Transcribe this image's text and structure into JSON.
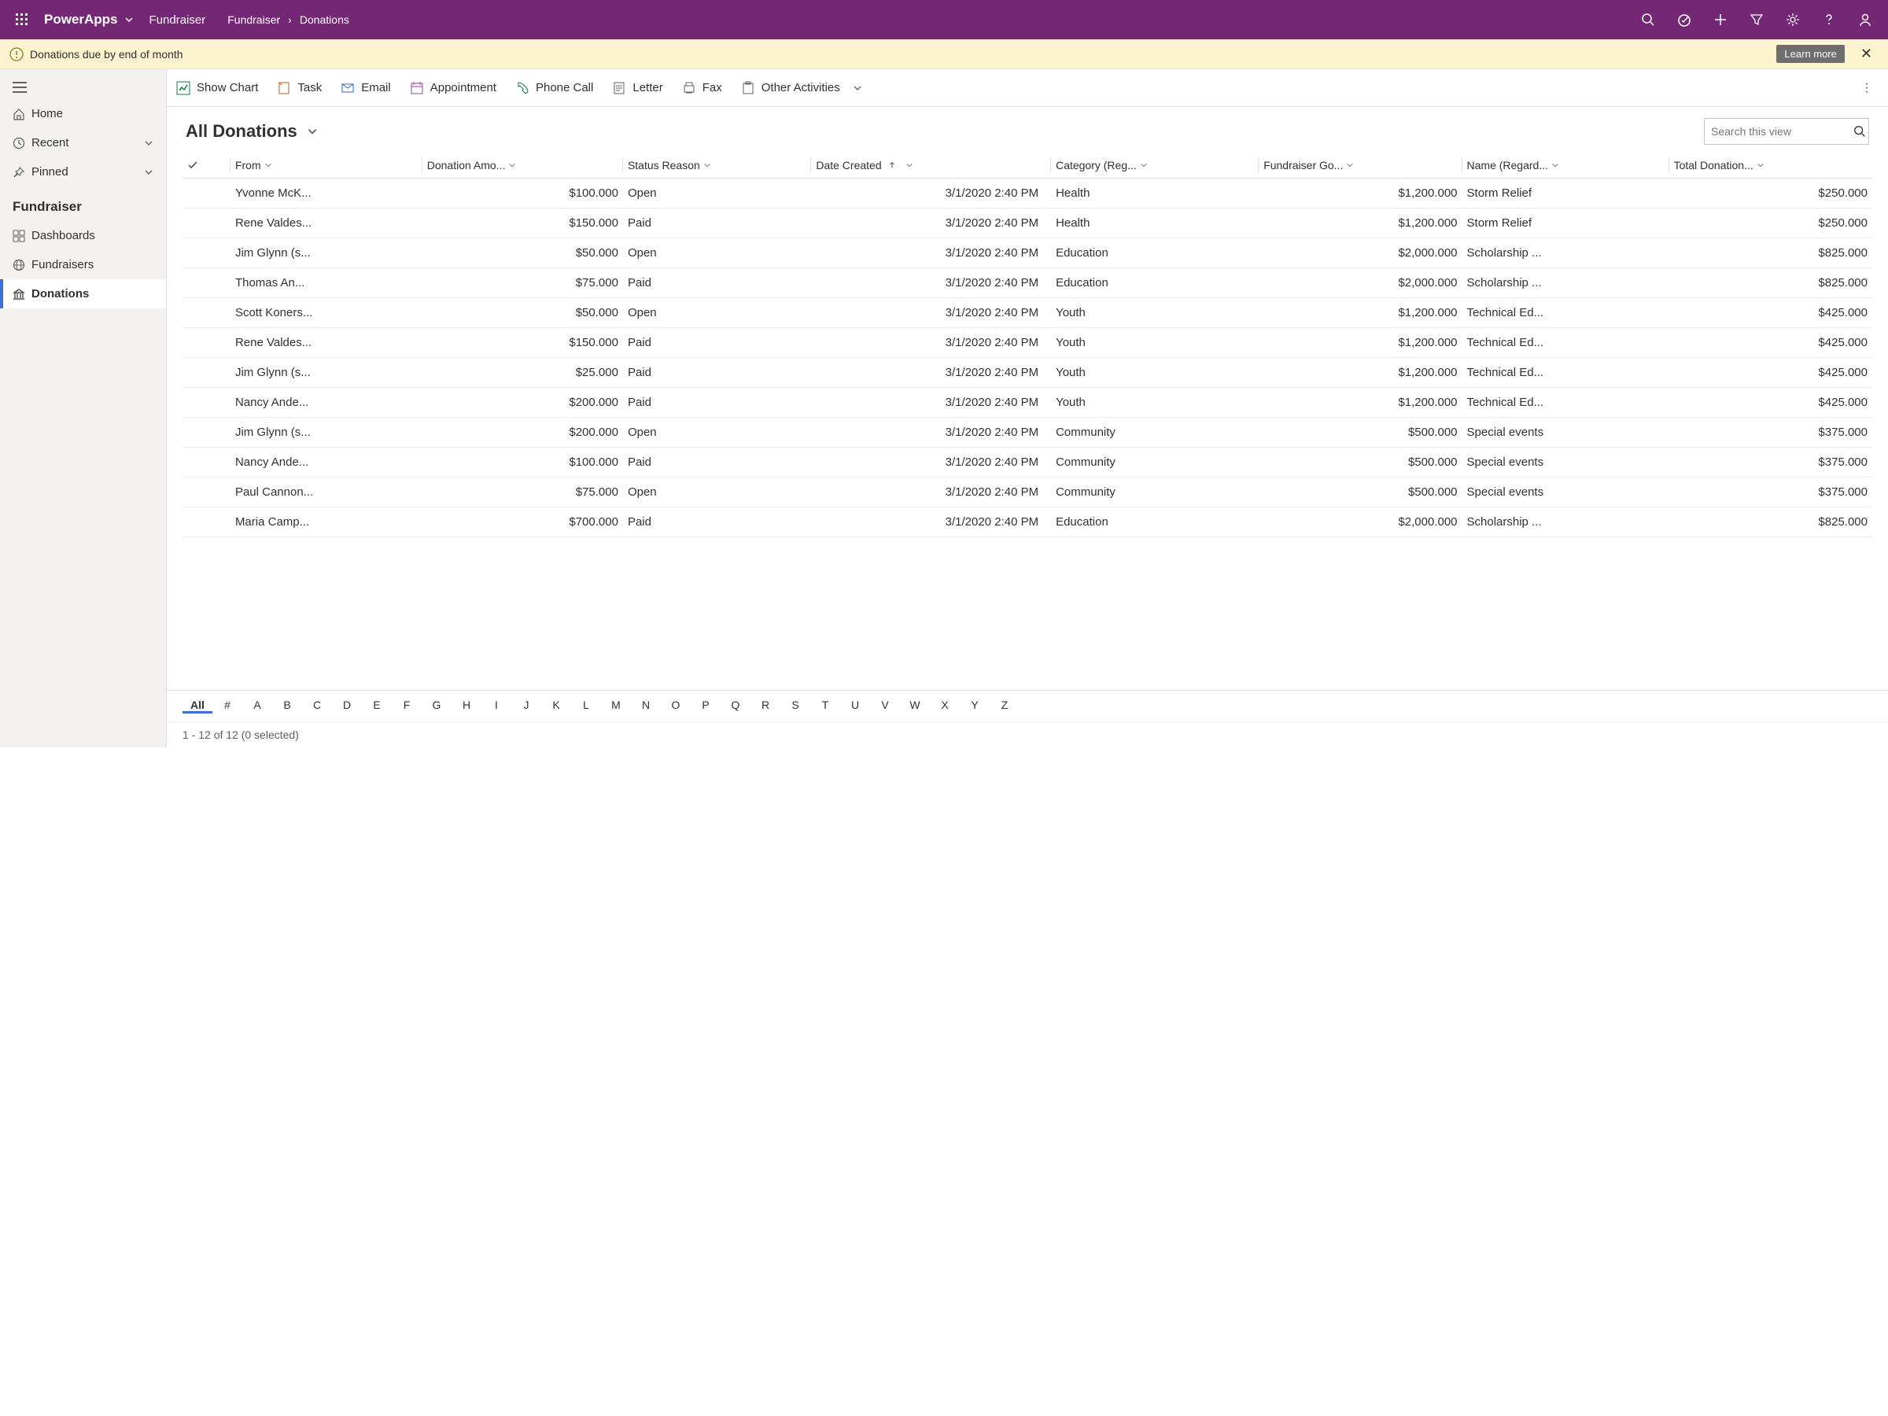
{
  "topbar": {
    "app_name": "PowerApps",
    "env_name": "Fundraiser",
    "breadcrumb": [
      "Fundraiser",
      "Donations"
    ]
  },
  "notif": {
    "message": "Donations due by end of month",
    "learn_more": "Learn more"
  },
  "sidebar": {
    "home": "Home",
    "recent": "Recent",
    "pinned": "Pinned",
    "section": "Fundraiser",
    "items": [
      {
        "label": "Dashboards"
      },
      {
        "label": "Fundraisers"
      },
      {
        "label": "Donations"
      }
    ]
  },
  "cmdbar": {
    "show_chart": "Show Chart",
    "task": "Task",
    "email": "Email",
    "appointment": "Appointment",
    "phone_call": "Phone Call",
    "letter": "Letter",
    "fax": "Fax",
    "other": "Other Activities"
  },
  "view": {
    "title": "All Donations",
    "search_placeholder": "Search this view"
  },
  "columns": {
    "from": "From",
    "amount": "Donation Amo...",
    "status": "Status Reason",
    "date": "Date Created",
    "category": "Category (Reg...",
    "goal": "Fundraiser Go...",
    "name": "Name (Regard...",
    "total": "Total Donation..."
  },
  "rows": [
    {
      "from": "Yvonne McK...",
      "amount": "$100.000",
      "status": "Open",
      "date": "3/1/2020 2:40 PM",
      "category": "Health",
      "goal": "$1,200.000",
      "name": "Storm Relief",
      "total": "$250.000"
    },
    {
      "from": "Rene Valdes...",
      "amount": "$150.000",
      "status": "Paid",
      "date": "3/1/2020 2:40 PM",
      "category": "Health",
      "goal": "$1,200.000",
      "name": "Storm Relief",
      "total": "$250.000"
    },
    {
      "from": "Jim Glynn (s...",
      "amount": "$50.000",
      "status": "Open",
      "date": "3/1/2020 2:40 PM",
      "category": "Education",
      "goal": "$2,000.000",
      "name": "Scholarship ...",
      "total": "$825.000"
    },
    {
      "from": "Thomas An...",
      "amount": "$75.000",
      "status": "Paid",
      "date": "3/1/2020 2:40 PM",
      "category": "Education",
      "goal": "$2,000.000",
      "name": "Scholarship ...",
      "total": "$825.000"
    },
    {
      "from": "Scott Koners...",
      "amount": "$50.000",
      "status": "Open",
      "date": "3/1/2020 2:40 PM",
      "category": "Youth",
      "goal": "$1,200.000",
      "name": "Technical Ed...",
      "total": "$425.000"
    },
    {
      "from": "Rene Valdes...",
      "amount": "$150.000",
      "status": "Paid",
      "date": "3/1/2020 2:40 PM",
      "category": "Youth",
      "goal": "$1,200.000",
      "name": "Technical Ed...",
      "total": "$425.000"
    },
    {
      "from": "Jim Glynn (s...",
      "amount": "$25.000",
      "status": "Paid",
      "date": "3/1/2020 2:40 PM",
      "category": "Youth",
      "goal": "$1,200.000",
      "name": "Technical Ed...",
      "total": "$425.000"
    },
    {
      "from": "Nancy Ande...",
      "amount": "$200.000",
      "status": "Paid",
      "date": "3/1/2020 2:40 PM",
      "category": "Youth",
      "goal": "$1,200.000",
      "name": "Technical Ed...",
      "total": "$425.000"
    },
    {
      "from": "Jim Glynn (s...",
      "amount": "$200.000",
      "status": "Open",
      "date": "3/1/2020 2:40 PM",
      "category": "Community",
      "goal": "$500.000",
      "name": "Special events",
      "total": "$375.000"
    },
    {
      "from": "Nancy Ande...",
      "amount": "$100.000",
      "status": "Paid",
      "date": "3/1/2020 2:40 PM",
      "category": "Community",
      "goal": "$500.000",
      "name": "Special events",
      "total": "$375.000"
    },
    {
      "from": "Paul Cannon...",
      "amount": "$75.000",
      "status": "Open",
      "date": "3/1/2020 2:40 PM",
      "category": "Community",
      "goal": "$500.000",
      "name": "Special events",
      "total": "$375.000"
    },
    {
      "from": "Maria Camp...",
      "amount": "$700.000",
      "status": "Paid",
      "date": "3/1/2020 2:40 PM",
      "category": "Education",
      "goal": "$2,000.000",
      "name": "Scholarship ...",
      "total": "$825.000"
    }
  ],
  "alpha": [
    "All",
    "#",
    "A",
    "B",
    "C",
    "D",
    "E",
    "F",
    "G",
    "H",
    "I",
    "J",
    "K",
    "L",
    "M",
    "N",
    "O",
    "P",
    "Q",
    "R",
    "S",
    "T",
    "U",
    "V",
    "W",
    "X",
    "Y",
    "Z"
  ],
  "status_text": "1 - 12 of 12 (0 selected)"
}
